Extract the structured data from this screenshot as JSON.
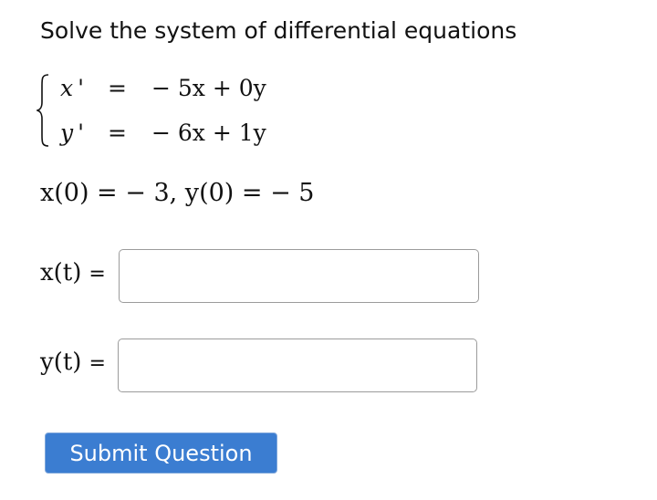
{
  "question": {
    "prompt": "Solve the system of differential equations",
    "system": [
      {
        "lhs": "x '",
        "eq": "=",
        "rhs": "− 5x + 0y"
      },
      {
        "lhs": "y '",
        "eq": "=",
        "rhs": "− 6x + 1y"
      }
    ],
    "initial_conditions": "x(0) = − 3,  y(0) = − 5"
  },
  "answers": [
    {
      "label": "x(t)",
      "equals": "=",
      "value": "",
      "placeholder": ""
    },
    {
      "label": "y(t)",
      "equals": "=",
      "value": "",
      "placeholder": ""
    }
  ],
  "submit_label": "Submit Question",
  "colors": {
    "submit_bg": "#3b7dd1",
    "input_border": "#9b9b9b"
  }
}
